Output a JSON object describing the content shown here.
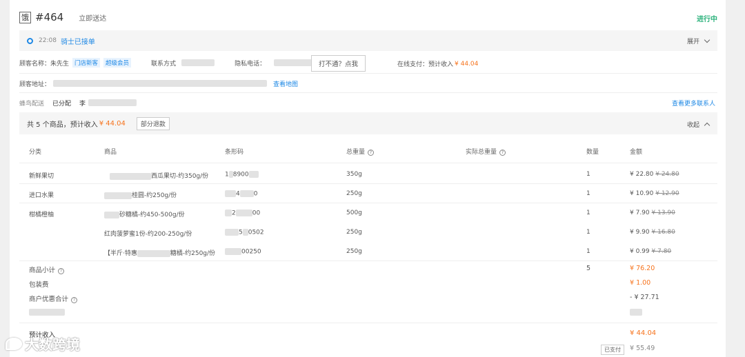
{
  "header": {
    "tag": "饿",
    "order_no": "#464",
    "order_type": "立即送达",
    "status": "进行中"
  },
  "rider": {
    "time": "22:08",
    "status": "骑士已接单",
    "expand_label": "展开"
  },
  "customer": {
    "name_label": "顾客名称：朱先生",
    "badge1": "门店新客",
    "badge2": "超级会员",
    "contact_label": "联系方式",
    "privacy_label": "隐私电话：",
    "call_button": "打不通？点我",
    "payment_label": "在线支付：预计收入",
    "payment_amount": "¥ 44.04",
    "address_label": "顾客地址：",
    "map_link": "查看地图"
  },
  "delivery": {
    "label": "蜂鸟配送",
    "state": "已分配",
    "rider_prefix": "李",
    "more_contacts": "查看更多联系人"
  },
  "goods": {
    "summary_prefix": "共 5 个商品，预计收入",
    "summary_amount": "¥ 44.04",
    "refund_button": "部分退款",
    "collapse_label": "收起",
    "columns": [
      "分类",
      "商品",
      "条形码",
      "总重量",
      "实际总重量",
      "数量",
      "金额"
    ],
    "rows": [
      {
        "category": "新鲜果切",
        "name": "西瓜果切-约350g/份",
        "barcode": "8900",
        "barcode_prefix": "1",
        "weight": "350g",
        "qty": "1",
        "price": "¥ 22.80",
        "orig": "¥ 24.80"
      },
      {
        "category": "进口水果",
        "name": "桂圆-约250g/份",
        "barcode": "0",
        "barcode_prefix": "4",
        "weight": "250g",
        "qty": "1",
        "price": "¥ 10.90",
        "orig": "¥ 12.90"
      },
      {
        "category": "柑橘橙柚",
        "name": "砂糖橘-约450-500g/份",
        "barcode": "00",
        "barcode_prefix": "2",
        "weight": "500g",
        "qty": "1",
        "price": "¥ 7.90",
        "orig": "¥ 13.90"
      },
      {
        "category": "",
        "name": "红肉菠萝蜜1份-约200-250g/份",
        "barcode": "0502",
        "barcode_prefix": "5",
        "weight": "250g",
        "qty": "1",
        "price": "¥ 9.90",
        "orig": "¥ 16.80"
      },
      {
        "category": "",
        "name": "【半斤·特惠",
        "name_suffix": "糖橘-约250g/份",
        "barcode": "00250",
        "barcode_prefix": "",
        "weight": "250g",
        "qty": "1",
        "price": "¥ 0.99",
        "orig": "¥ 7.80"
      }
    ]
  },
  "summary": {
    "subtotal_label": "商品小计",
    "subtotal_qty": "5",
    "subtotal_amount": "¥ 76.20",
    "packing_label": "包装费",
    "packing_amount": "¥ 1.00",
    "discount_label": "商户优惠合计",
    "discount_amount": "- ¥ 27.71",
    "income_label": "预计收入",
    "income_amount": "¥ 44.04",
    "paid_badge": "已支付",
    "paid_amount": "¥ 55.49"
  },
  "watermark": {
    "text": "大数跨境"
  },
  "colors": {
    "accent_blue": "#1e88e5",
    "status_green": "#2cb27c",
    "price_orange": "#f6731d"
  }
}
